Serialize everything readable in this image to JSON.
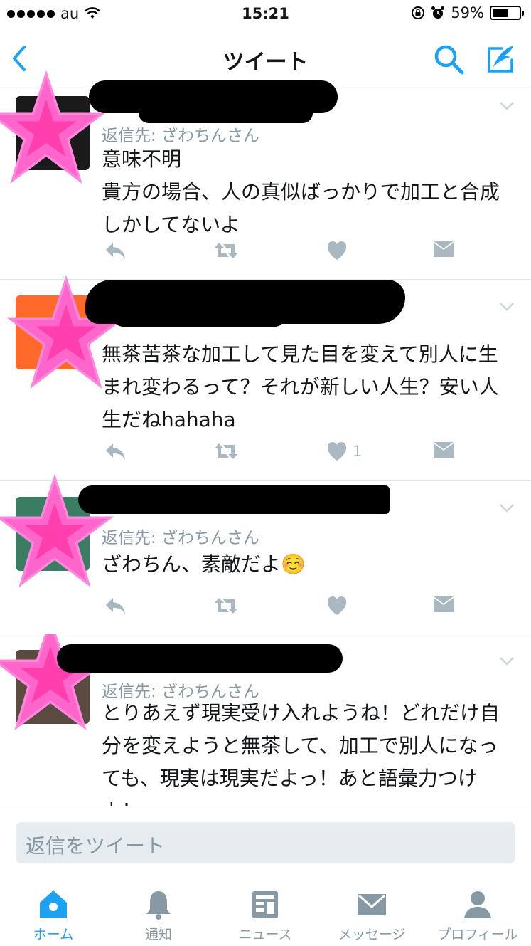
{
  "status_bar": {
    "carrier": "au",
    "time": "15:21",
    "battery": "59%",
    "battery_level": 0.59
  },
  "nav": {
    "title": "ツイート"
  },
  "tweets": [
    {
      "reply_to": "返信先: ざわちんさん",
      "text": "意味不明\n貴方の場合、人の真似ばっかりで加工と合成しかしてないよ",
      "like_count": ""
    },
    {
      "reply_to": "",
      "text": "無茶苦茶な加工して見た目を変えて別人に生まれ変わるって？それが新しい人生？安い人生だねhahaha",
      "like_count": "1"
    },
    {
      "reply_to": "返信先: ざわちんさん",
      "text": "ざわちん、素敵だよ☺️",
      "like_count": ""
    },
    {
      "reply_to": "返信先: ざわちんさん",
      "text": "とりあえず現実受け入れようね！どれだけ自分を変えようと無茶して、加工で別人になっても、現実は現実だよっ！あと語彙力つけよ！",
      "like_count": ""
    }
  ],
  "reply_bar": {
    "placeholder": "返信をツイート"
  },
  "tabs": [
    {
      "label": "ホーム",
      "icon": "home-icon",
      "active": true
    },
    {
      "label": "通知",
      "icon": "bell-icon",
      "active": false
    },
    {
      "label": "ニュース",
      "icon": "news-icon",
      "active": false
    },
    {
      "label": "メッセージ",
      "icon": "envelope-icon",
      "active": false
    },
    {
      "label": "プロフィール",
      "icon": "person-icon",
      "active": false
    }
  ],
  "colors": {
    "accent": "#1da1f2",
    "muted": "#8899a6",
    "icon_gray": "#aab8c2",
    "star_pink": "#ff66cc",
    "star_center": "#ff3fae"
  }
}
